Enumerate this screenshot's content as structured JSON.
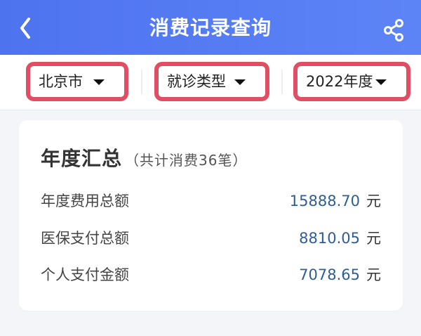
{
  "header": {
    "title": "消费记录查询",
    "back_icon": "chevron-left-icon",
    "share_icon": "share-icon"
  },
  "filters": [
    {
      "label": "北京市",
      "icon": "caret-down-icon"
    },
    {
      "label": "就诊类型",
      "icon": "caret-down-icon"
    },
    {
      "label": "2022年度",
      "icon": "caret-down-icon"
    }
  ],
  "summary": {
    "title": "年度汇总",
    "subtitle": "（共计消费36笔）",
    "rows": [
      {
        "label": "年度费用总额",
        "value": "15888.70",
        "unit": "元"
      },
      {
        "label": "医保支付总额",
        "value": "8810.05",
        "unit": "元"
      },
      {
        "label": "个人支付金额",
        "value": "7078.65",
        "unit": "元"
      }
    ]
  },
  "colors": {
    "header_blue": "#4E73EF",
    "filter_highlight": "#E14E63",
    "amount_blue": "#2F5D95",
    "page_bg": "#F3F5F9",
    "card_bg": "#FFFFFF"
  }
}
